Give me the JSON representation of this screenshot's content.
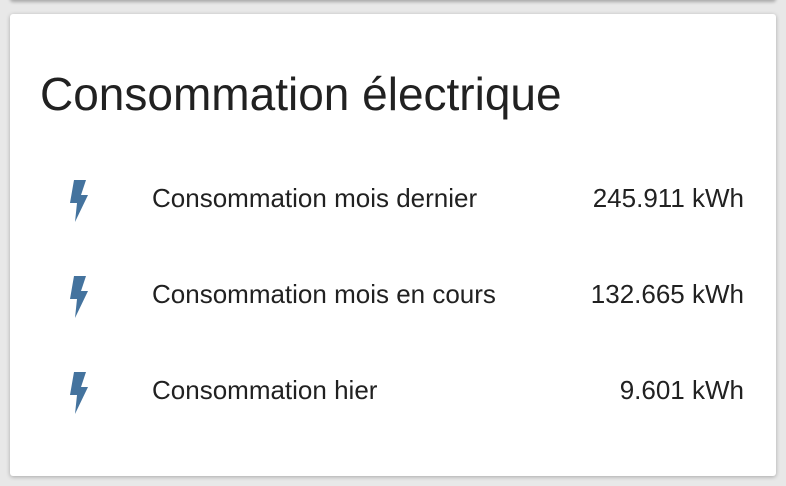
{
  "card": {
    "title": "Consommation électrique",
    "entities": [
      {
        "name": "Consommation mois dernier",
        "state": "245.911 kWh",
        "icon": "flash-icon"
      },
      {
        "name": "Consommation mois en cours",
        "state": "132.665 kWh",
        "icon": "flash-icon"
      },
      {
        "name": "Consommation hier",
        "state": "9.601 kWh",
        "icon": "flash-icon"
      }
    ]
  },
  "colors": {
    "icon": "#44739e",
    "text": "#212121",
    "card_background": "#ffffff",
    "page_background": "#e8e8e8"
  }
}
